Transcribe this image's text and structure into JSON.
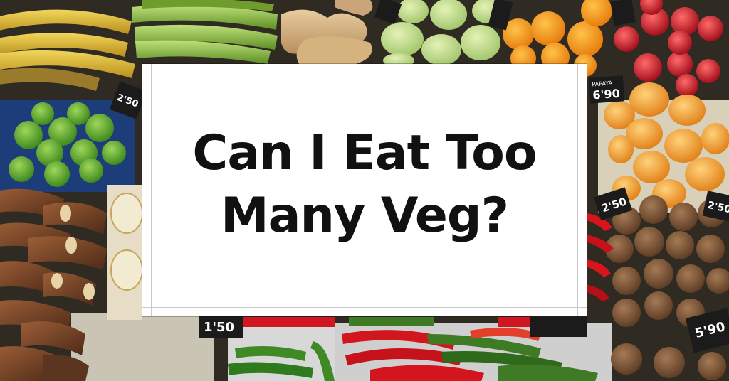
{
  "title": {
    "line1": "Can I Eat Too",
    "line2": "Many Veg?"
  },
  "price_tags": {
    "papaya": "6'90",
    "left_small": "2'50",
    "bottom_left": "1'50",
    "bottom_right": "5'90",
    "right_mid": "2'50",
    "far_right": "2'50"
  },
  "colors": {
    "card_background": "#ffffff",
    "headline_text": "#111111"
  }
}
